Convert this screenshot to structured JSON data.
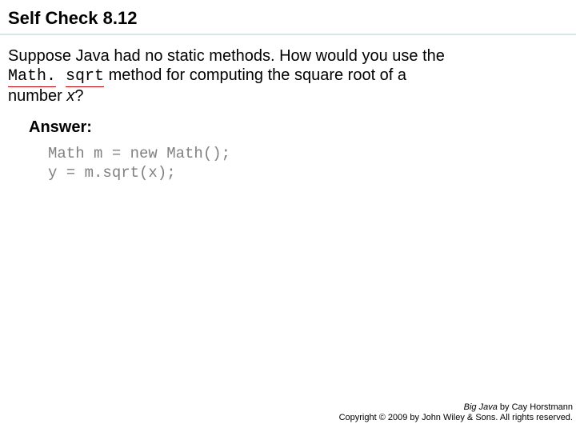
{
  "title": "Self Check 8.12",
  "question": {
    "line1_prefix": "Suppose Java had no static methods. How would you use the ",
    "code_word1": "Math.",
    "code_word2": "sqrt",
    "line2_mid": " method for computing the square root of a ",
    "line3_prefix": "number ",
    "var": "x",
    "line3_suffix": "?"
  },
  "answer_label": "Answer:",
  "code": "Math m = new Math();\ny = m.sqrt(x);",
  "footer": {
    "book_title": "Big Java",
    "byline": " by Cay Horstmann",
    "copyright": "Copyright © 2009 by John Wiley & Sons. All rights reserved."
  }
}
